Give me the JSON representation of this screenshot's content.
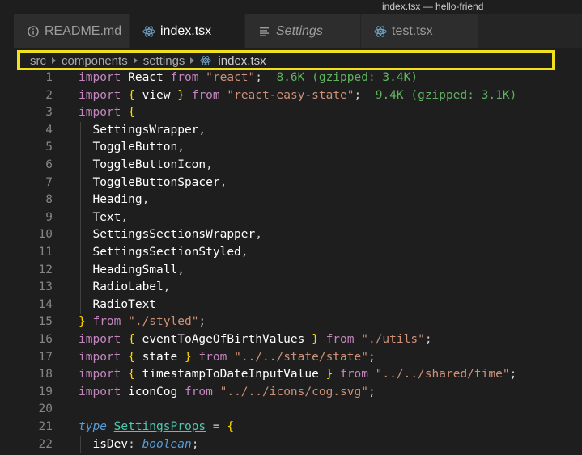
{
  "window": {
    "title": "index.tsx — hello-friend"
  },
  "tabs": [
    {
      "label": "README.md",
      "icon": "info-icon",
      "active": false,
      "italic": false
    },
    {
      "label": "index.tsx",
      "icon": "react-icon",
      "active": true,
      "italic": false
    },
    {
      "label": "Settings",
      "icon": "lines-icon",
      "active": false,
      "italic": true
    },
    {
      "label": "test.tsx",
      "icon": "react-icon",
      "active": false,
      "italic": false
    }
  ],
  "breadcrumb": {
    "items": [
      "src",
      "components",
      "settings",
      "index.tsx"
    ],
    "highlight_color": "#f0e11c"
  },
  "editor": {
    "lines": [
      {
        "num": "1",
        "tokens": [
          [
            "kw",
            "import"
          ],
          [
            "var",
            " React "
          ],
          [
            "kw",
            "from"
          ],
          [
            "str",
            " \"react\""
          ],
          [
            "pun",
            ";"
          ],
          [
            "size",
            "  8.6K (gzipped: 3.4K)"
          ]
        ]
      },
      {
        "num": "2",
        "tokens": [
          [
            "kw",
            "import"
          ],
          [
            "br",
            " {"
          ],
          [
            "var",
            " view "
          ],
          [
            "br",
            "}"
          ],
          [
            "kw",
            " from"
          ],
          [
            "str",
            " \"react-easy-state\""
          ],
          [
            "pun",
            ";"
          ],
          [
            "size",
            "  9.4K (gzipped: 3.1K)"
          ]
        ]
      },
      {
        "num": "3",
        "tokens": [
          [
            "kw",
            "import"
          ],
          [
            "br",
            " {"
          ]
        ]
      },
      {
        "num": "4",
        "tokens": [
          [
            "var",
            "  SettingsWrapper"
          ],
          [
            "pun",
            ","
          ]
        ]
      },
      {
        "num": "5",
        "tokens": [
          [
            "var",
            "  ToggleButton"
          ],
          [
            "pun",
            ","
          ]
        ]
      },
      {
        "num": "6",
        "tokens": [
          [
            "var",
            "  ToggleButtonIcon"
          ],
          [
            "pun",
            ","
          ]
        ]
      },
      {
        "num": "7",
        "tokens": [
          [
            "var",
            "  ToggleButtonSpacer"
          ],
          [
            "pun",
            ","
          ]
        ]
      },
      {
        "num": "8",
        "tokens": [
          [
            "var",
            "  Heading"
          ],
          [
            "pun",
            ","
          ]
        ]
      },
      {
        "num": "9",
        "tokens": [
          [
            "var",
            "  Text"
          ],
          [
            "pun",
            ","
          ]
        ]
      },
      {
        "num": "10",
        "tokens": [
          [
            "var",
            "  SettingsSectionsWrapper"
          ],
          [
            "pun",
            ","
          ]
        ]
      },
      {
        "num": "11",
        "tokens": [
          [
            "var",
            "  SettingsSectionStyled"
          ],
          [
            "pun",
            ","
          ]
        ]
      },
      {
        "num": "12",
        "tokens": [
          [
            "var",
            "  HeadingSmall"
          ],
          [
            "pun",
            ","
          ]
        ]
      },
      {
        "num": "13",
        "tokens": [
          [
            "var",
            "  RadioLabel"
          ],
          [
            "pun",
            ","
          ]
        ]
      },
      {
        "num": "14",
        "tokens": [
          [
            "var",
            "  RadioText"
          ]
        ]
      },
      {
        "num": "15",
        "tokens": [
          [
            "br",
            "}"
          ],
          [
            "kw",
            " from"
          ],
          [
            "str",
            " \"./styled\""
          ],
          [
            "pun",
            ";"
          ]
        ]
      },
      {
        "num": "16",
        "tokens": [
          [
            "kw",
            "import"
          ],
          [
            "br",
            " {"
          ],
          [
            "var",
            " eventToAgeOfBirthValues "
          ],
          [
            "br",
            "}"
          ],
          [
            "kw",
            " from"
          ],
          [
            "str",
            " \"./utils\""
          ],
          [
            "pun",
            ";"
          ]
        ]
      },
      {
        "num": "17",
        "tokens": [
          [
            "kw",
            "import"
          ],
          [
            "br",
            " {"
          ],
          [
            "var",
            " state "
          ],
          [
            "br",
            "}"
          ],
          [
            "kw",
            " from"
          ],
          [
            "str",
            " \"../../state/state\""
          ],
          [
            "pun",
            ";"
          ]
        ]
      },
      {
        "num": "18",
        "tokens": [
          [
            "kw",
            "import"
          ],
          [
            "br",
            " {"
          ],
          [
            "var",
            " timestampToDateInputValue "
          ],
          [
            "br",
            "}"
          ],
          [
            "kw",
            " from"
          ],
          [
            "str",
            " \"../../shared/time\""
          ],
          [
            "pun",
            ";"
          ]
        ]
      },
      {
        "num": "19",
        "tokens": [
          [
            "kw",
            "import"
          ],
          [
            "var",
            " iconCog "
          ],
          [
            "kw",
            "from"
          ],
          [
            "str",
            " \"../../icons/cog.svg\""
          ],
          [
            "pun",
            ";"
          ]
        ]
      },
      {
        "num": "20",
        "tokens": []
      },
      {
        "num": "21",
        "tokens": [
          [
            "typekw",
            "type"
          ],
          [
            "pun",
            " "
          ],
          [
            "cls",
            "SettingsProps"
          ],
          [
            "pun",
            " = "
          ],
          [
            "br",
            "{"
          ]
        ]
      },
      {
        "num": "22",
        "tokens": [
          [
            "var",
            "  isDev"
          ],
          [
            "pun",
            ": "
          ],
          [
            "type",
            "boolean"
          ],
          [
            "pun",
            ";"
          ]
        ]
      }
    ]
  }
}
